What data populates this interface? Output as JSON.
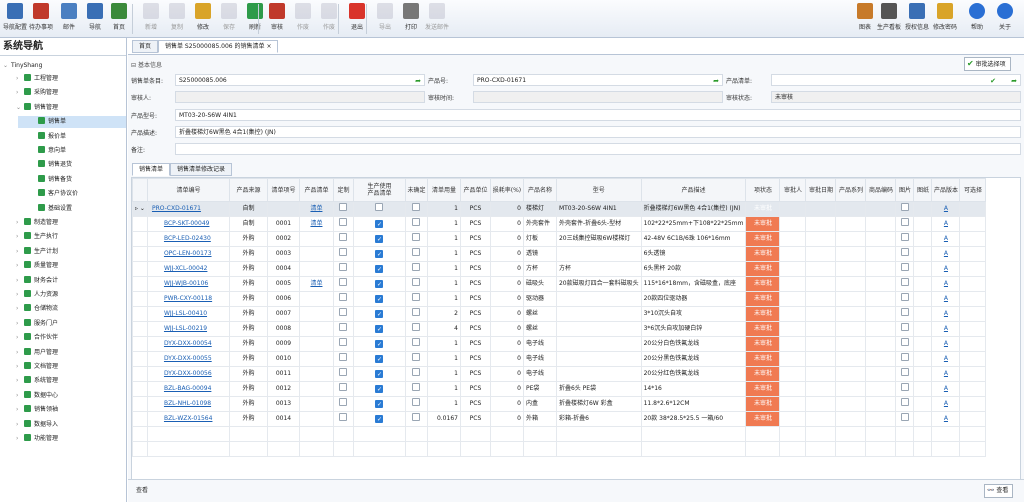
{
  "toolbar": {
    "left": [
      {
        "label": "导航配置",
        "color": "#3a6fb5"
      },
      {
        "label": "待办事项",
        "color": "#c0392b"
      },
      {
        "label": "邮件",
        "color": "#4a7fc1"
      },
      {
        "label": "导航",
        "color": "#3a6fb5"
      },
      {
        "label": "首页",
        "color": "#3b8a3b"
      },
      {
        "label": "新增",
        "color": "#aab"
      },
      {
        "label": "复制",
        "color": "#aab"
      },
      {
        "label": "修改",
        "color": "#d9a429"
      },
      {
        "label": "保存",
        "color": "#aab"
      },
      {
        "label": "刷新",
        "color": "#2e9b4a"
      },
      {
        "label": "审核",
        "color": "#c0392b"
      },
      {
        "label": "作废",
        "color": "#aab"
      },
      {
        "label": "作废",
        "color": "#aab"
      },
      {
        "label": "退出",
        "color": "#d9342b"
      },
      {
        "label": "导出",
        "color": "#aab"
      },
      {
        "label": "打印",
        "color": "#777"
      },
      {
        "label": "发送邮件",
        "color": "#aab"
      }
    ],
    "right": [
      {
        "label": "图表",
        "color": "#c77a2a"
      },
      {
        "label": "生产看板",
        "color": "#555"
      },
      {
        "label": "授权信息",
        "color": "#3a6fb5"
      },
      {
        "label": "修改密码",
        "color": "#d9a429"
      },
      {
        "label": "帮助",
        "color": "#2a6fd4"
      },
      {
        "label": "关于",
        "color": "#2a6fd4"
      }
    ]
  },
  "nav": {
    "title": "系统导航",
    "root": "TinyShang",
    "items": [
      {
        "label": "工程管理",
        "level": 1,
        "color": "#2e9b4a"
      },
      {
        "label": "采购管理",
        "level": 1,
        "color": "#2e9b4a"
      },
      {
        "label": "销售管理",
        "level": 1,
        "color": "#2e9b4a"
      },
      {
        "label": "销售单",
        "level": 2,
        "color": "#2e9b4a",
        "selected": true
      },
      {
        "label": "报价单",
        "level": 2,
        "color": "#2e9b4a"
      },
      {
        "label": "意向单",
        "level": 2,
        "color": "#2e9b4a"
      },
      {
        "label": "销售退货",
        "level": 2,
        "color": "#2e9b4a"
      },
      {
        "label": "销售备货",
        "level": 2,
        "color": "#2e9b4a"
      },
      {
        "label": "客户协议价",
        "level": 2,
        "color": "#2e9b4a"
      },
      {
        "label": "基础设置",
        "level": 2,
        "color": "#2e9b4a"
      },
      {
        "label": "制造管理",
        "level": 1,
        "color": "#2e9b4a"
      },
      {
        "label": "生产执行",
        "level": 1,
        "color": "#2e9b4a"
      },
      {
        "label": "生产计划",
        "level": 1,
        "color": "#2e9b4a"
      },
      {
        "label": "质量管理",
        "level": 1,
        "color": "#2e9b4a"
      },
      {
        "label": "财务会计",
        "level": 1,
        "color": "#2e9b4a"
      },
      {
        "label": "人力资源",
        "level": 1,
        "color": "#2e9b4a"
      },
      {
        "label": "仓储物流",
        "level": 1,
        "color": "#2e9b4a"
      },
      {
        "label": "服务门户",
        "level": 1,
        "color": "#2e9b4a"
      },
      {
        "label": "合作伙伴",
        "level": 1,
        "color": "#2e9b4a"
      },
      {
        "label": "用户管理",
        "level": 1,
        "color": "#2e9b4a"
      },
      {
        "label": "文档管理",
        "level": 1,
        "color": "#2e9b4a"
      },
      {
        "label": "系统管理",
        "level": 1,
        "color": "#2e9b4a"
      },
      {
        "label": "数据中心",
        "level": 1,
        "color": "#2e9b4a"
      },
      {
        "label": "销售领袖",
        "level": 1,
        "color": "#2e9b4a"
      },
      {
        "label": "数据导入",
        "level": 1,
        "color": "#2e9b4a"
      },
      {
        "label": "功能管理",
        "level": 1,
        "color": "#2e9b4a"
      }
    ]
  },
  "tabs": {
    "home": "首页",
    "active": "销售单 S25000085.006 的销售清单"
  },
  "form": {
    "section": "基本信息",
    "approve_btn": "审批选择项",
    "so_label": "销售单条目:",
    "so_value": "S25000085.006",
    "pn_label": "产品号:",
    "pn_value": "PRO-CXD-01671",
    "pl_label": "产品清单:",
    "rv_label": "审核人:",
    "rv_value": "",
    "rt_label": "审核时间:",
    "rt_value": "",
    "rs_label": "审核状态:",
    "rs_value": "未审核",
    "model_label": "产品型号:",
    "model_value": "MT03-20-S6W 4IN1",
    "desc_label": "产品描述:",
    "desc_value": "折叠楼梯灯6W黑色 4合1(集控) (JN)",
    "note_label": "备注:",
    "note_value": ""
  },
  "subtabs": [
    "销售清单",
    "销售清单修改记录"
  ],
  "grid": {
    "headers": [
      "清单编号",
      "产品来源",
      "清单项号",
      "产品清单",
      "定制",
      "生产使用\n产品清单",
      "未确定",
      "清单用量",
      "产品单位",
      "损耗率(%)",
      "产品名称",
      "型号",
      "产品描述",
      "项状态",
      "审批人",
      "审批日期",
      "产品系列",
      "商品编码",
      "图片",
      "图纸",
      "产品版本",
      "可选择"
    ],
    "rows": [
      {
        "code": "PRO-CXD-01671",
        "source": "自制",
        "item": "",
        "list": "清单",
        "custom": false,
        "prod": false,
        "undet": false,
        "qty": "1",
        "unit": "PCS",
        "loss": "0",
        "name": "楼梯灯",
        "model": "MT03-20-S6W 4IN1",
        "desc": "折叠楼梯灯6W黑色 4合1(集控) (JN)",
        "status": "未审批",
        "ver": "A",
        "first": true
      },
      {
        "code": "BCP-SKT-00049",
        "source": "自制",
        "item": "0001",
        "list": "清单",
        "custom": false,
        "prod": true,
        "undet": false,
        "qty": "1",
        "unit": "PCS",
        "loss": "0",
        "name": "外壳套件",
        "model": "外壳套件-折叠6头-型材",
        "desc": "102*22*25mm+下108*22*25mm",
        "status": "未审批",
        "ver": "A"
      },
      {
        "code": "BCP-LED-02430",
        "source": "外购",
        "item": "0002",
        "list": "",
        "custom": false,
        "prod": true,
        "undet": false,
        "qty": "1",
        "unit": "PCS",
        "loss": "0",
        "name": "灯板",
        "model": "20三线集控磁吸6W楼梯灯",
        "desc": "42-48V 6C1B/6珠 106*16mm",
        "status": "未审批",
        "ver": "A"
      },
      {
        "code": "OPC-LEN-00173",
        "source": "外购",
        "item": "0003",
        "list": "",
        "custom": false,
        "prod": true,
        "undet": false,
        "qty": "1",
        "unit": "PCS",
        "loss": "0",
        "name": "透镜",
        "model": "",
        "desc": "6头透镜",
        "status": "未审批",
        "ver": "A"
      },
      {
        "code": "WJJ-XCL-00042",
        "source": "外购",
        "item": "0004",
        "list": "",
        "custom": false,
        "prod": true,
        "undet": false,
        "qty": "1",
        "unit": "PCS",
        "loss": "0",
        "name": "方杯",
        "model": "方杯",
        "desc": "6头黑杯 20款",
        "status": "未审批",
        "ver": "A"
      },
      {
        "code": "WJJ-WJB-00106",
        "source": "外购",
        "item": "0005",
        "list": "清单",
        "custom": false,
        "prod": true,
        "undet": false,
        "qty": "1",
        "unit": "PCS",
        "loss": "0",
        "name": "磁吸头",
        "model": "20款磁吸灯四合一套料磁吸头",
        "desc": "115*16*18mm，含磁吸盒，底座",
        "status": "未审批",
        "ver": "A"
      },
      {
        "code": "PWR-CXY-00118",
        "source": "外购",
        "item": "0006",
        "list": "",
        "custom": false,
        "prod": true,
        "undet": false,
        "qty": "1",
        "unit": "PCS",
        "loss": "0",
        "name": "驱动器",
        "model": "",
        "desc": "20款四位驱动器",
        "status": "未审批",
        "ver": "A"
      },
      {
        "code": "WJJ-LSL-00410",
        "source": "外购",
        "item": "0007",
        "list": "",
        "custom": false,
        "prod": true,
        "undet": false,
        "qty": "2",
        "unit": "PCS",
        "loss": "0",
        "name": "螺丝",
        "model": "",
        "desc": "3*10沉头自攻",
        "status": "未审批",
        "ver": "A"
      },
      {
        "code": "WJJ-LSL-00219",
        "source": "外购",
        "item": "0008",
        "list": "",
        "custom": false,
        "prod": true,
        "undet": false,
        "qty": "4",
        "unit": "PCS",
        "loss": "0",
        "name": "螺丝",
        "model": "",
        "desc": "3*6沉头自攻加硬白锌",
        "status": "未审批",
        "ver": "A"
      },
      {
        "code": "DYX-DXX-00054",
        "source": "外购",
        "item": "0009",
        "list": "",
        "custom": false,
        "prod": true,
        "undet": false,
        "qty": "1",
        "unit": "PCS",
        "loss": "0",
        "name": "电子线",
        "model": "",
        "desc": "20公分白色铁氟龙线",
        "status": "未审批",
        "ver": "A"
      },
      {
        "code": "DYX-DXX-00055",
        "source": "外购",
        "item": "0010",
        "list": "",
        "custom": false,
        "prod": true,
        "undet": false,
        "qty": "1",
        "unit": "PCS",
        "loss": "0",
        "name": "电子线",
        "model": "",
        "desc": "20公分黑色铁氟龙线",
        "status": "未审批",
        "ver": "A"
      },
      {
        "code": "DYX-DXX-00056",
        "source": "外购",
        "item": "0011",
        "list": "",
        "custom": false,
        "prod": true,
        "undet": false,
        "qty": "1",
        "unit": "PCS",
        "loss": "0",
        "name": "电子线",
        "model": "",
        "desc": "20公分红色铁氟龙线",
        "status": "未审批",
        "ver": "A"
      },
      {
        "code": "BZL-BAG-00094",
        "source": "外购",
        "item": "0012",
        "list": "",
        "custom": false,
        "prod": true,
        "undet": false,
        "qty": "1",
        "unit": "PCS",
        "loss": "0",
        "name": "PE袋",
        "model": "折叠6头 PE袋",
        "desc": "14*16",
        "status": "未审批",
        "ver": "A"
      },
      {
        "code": "BZL-NHL-01098",
        "source": "外购",
        "item": "0013",
        "list": "",
        "custom": false,
        "prod": true,
        "undet": false,
        "qty": "1",
        "unit": "PCS",
        "loss": "0",
        "name": "内盒",
        "model": "折叠楼梯灯6W 彩盒",
        "desc": "11.8*2.6*12CM",
        "status": "未审批",
        "ver": "A"
      },
      {
        "code": "BZL-WZX-01564",
        "source": "外购",
        "item": "0014",
        "list": "",
        "custom": false,
        "prod": true,
        "undet": false,
        "qty": "0.0167",
        "unit": "PCS",
        "loss": "0",
        "name": "外箱",
        "model": "彩箱-折叠6",
        "desc": "20款 38*28.5*25.5 一箱/60",
        "status": "未审批",
        "ver": "A"
      }
    ]
  },
  "footer": {
    "label": "查看",
    "btn": "查看"
  }
}
